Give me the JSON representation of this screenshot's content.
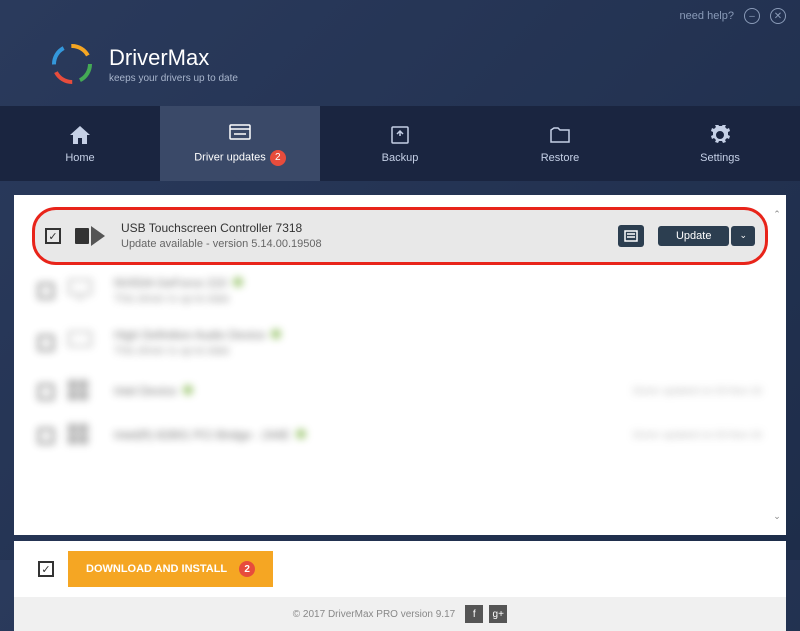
{
  "titlebar": {
    "help": "need help?"
  },
  "brand": {
    "name": "DriverMax",
    "tagline": "keeps your drivers up to date"
  },
  "nav": {
    "items": [
      {
        "label": "Home"
      },
      {
        "label": "Driver updates",
        "badge": "2"
      },
      {
        "label": "Backup"
      },
      {
        "label": "Restore"
      },
      {
        "label": "Settings"
      }
    ]
  },
  "drivers": [
    {
      "name": "USB Touchscreen Controller 7318",
      "sub": "Update available - version 5.14.00.19508",
      "action": "Update"
    },
    {
      "name": "NVIDIA GeForce 210",
      "sub": "This driver is up-to-date"
    },
    {
      "name": "High Definition Audio Device",
      "sub": "This driver is up-to-date"
    },
    {
      "name": "Intel Device",
      "sub": "",
      "right": "Driver updated on 03-Nov-16"
    },
    {
      "name": "Intel(R) 82801 PCI Bridge - 244E",
      "sub": "",
      "right": "Driver updated on 03-Nov-16"
    }
  ],
  "bottom": {
    "install": "DOWNLOAD AND INSTALL",
    "badge": "2"
  },
  "footer": {
    "copyright": "© 2017 DriverMax PRO version 9.17"
  }
}
